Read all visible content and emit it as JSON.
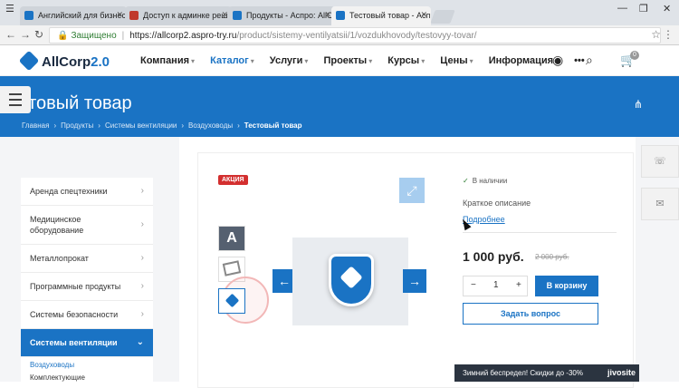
{
  "browser": {
    "tabs": [
      {
        "label": "Английский для бизнес",
        "icon": "site-favicon"
      },
      {
        "label": "Доступ к админке реш",
        "icon": "mail-favicon"
      },
      {
        "label": "Продукты - Аспро: AllCo",
        "icon": "site-favicon"
      },
      {
        "label": "Тестовый товар - Аспро",
        "icon": "site-favicon",
        "active": true
      }
    ],
    "user_label": "",
    "security_label": "Защищено",
    "url_host": "https://allcorp2.aspro-try.ru",
    "url_path": "/product/sistemy-ventilyatsii/1/vozdukhovody/testovyy-tovar/"
  },
  "header": {
    "logo_text": "AllCorp",
    "logo_version": "2.0",
    "nav": [
      {
        "label": "Компания",
        "caret": true,
        "active": false
      },
      {
        "label": "Каталог",
        "caret": true,
        "active": true
      },
      {
        "label": "Услуги",
        "caret": true,
        "active": false
      },
      {
        "label": "Проекты",
        "caret": true,
        "active": false
      },
      {
        "label": "Курсы",
        "caret": true,
        "active": false
      },
      {
        "label": "Цены",
        "caret": true,
        "active": false
      },
      {
        "label": "Информация",
        "caret": true,
        "active": false
      },
      {
        "label": "•••",
        "caret": false,
        "active": false
      }
    ],
    "cart_count": "0"
  },
  "banner": {
    "title": "естовый товар",
    "breadcrumb": [
      "Главная",
      "Продукты",
      "Системы вентиляции",
      "Воздуховоды",
      "Тестовый товар"
    ]
  },
  "sidebar": {
    "items": [
      {
        "label": "Аренда спецтехники"
      },
      {
        "label": "Медицинское оборудование"
      },
      {
        "label": "Металлопрокат"
      },
      {
        "label": "Программные продукты"
      },
      {
        "label": "Системы безопасности"
      },
      {
        "label": "Системы вентиляции",
        "active": true
      }
    ],
    "sub_items": [
      "Воздуховоды",
      "Комплектующие"
    ]
  },
  "product": {
    "badge": "АКЦИЯ",
    "thumb_letter": "A",
    "stock": "В наличии",
    "short_desc": "Краткое описание",
    "more_link": "Подробнее",
    "price": "1 000 руб.",
    "old_price": "2 000 руб.",
    "qty": "1",
    "qty_minus": "−",
    "qty_plus": "+",
    "cart_button": "В корзину",
    "ask_button": "Задать вопрос"
  },
  "chat": {
    "text": "Зимний беспредел! Скидки до -30%",
    "brand": "jivosite"
  },
  "colors": {
    "accent": "#1a73c4",
    "promo": "#d32f2f",
    "chat_bg": "#2b3440"
  }
}
